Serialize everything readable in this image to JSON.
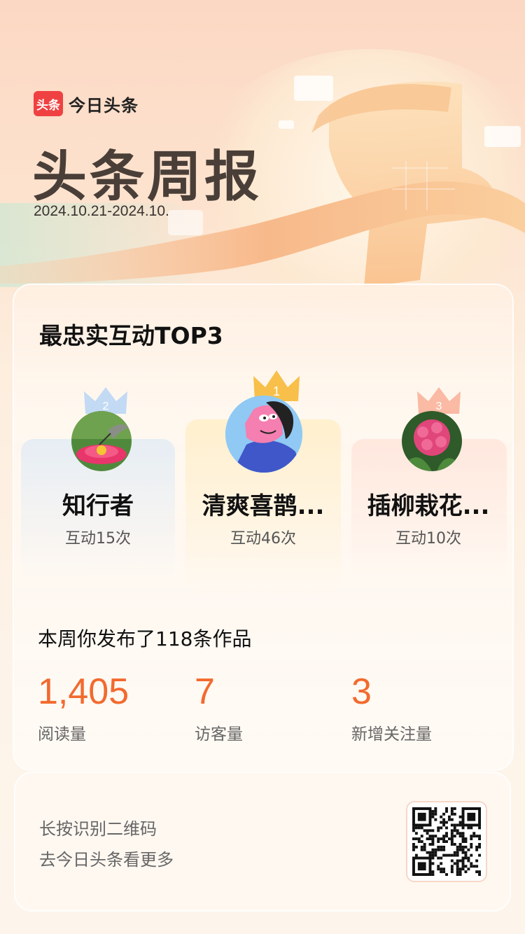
{
  "app": {
    "logo_badge": "头条",
    "logo_text": "今日头条"
  },
  "hero": {
    "title": "头条周报",
    "date_range": "2024.10.21-2024.10."
  },
  "top3": {
    "title": "最忠实互动TOP3",
    "ranks": [
      {
        "rank": "2",
        "name": "知行者",
        "count": "互动15次",
        "avatar_icon": "hummingbird-flower-avatar"
      },
      {
        "rank": "1",
        "name": "清爽喜鹊...",
        "count": "互动46次",
        "avatar_icon": "cartoon-dog-avatar"
      },
      {
        "rank": "3",
        "name": "插柳栽花...",
        "count": "互动10次",
        "avatar_icon": "hydrangea-avatar"
      }
    ]
  },
  "week": {
    "summary": "本周你发布了118条作品",
    "stats": [
      {
        "value": "1,405",
        "label": "阅读量"
      },
      {
        "value": "7",
        "label": "访客量"
      },
      {
        "value": "3",
        "label": "新增关注量"
      }
    ]
  },
  "footer": {
    "line1": "长按识别二维码",
    "line2": "去今日头条看更多"
  },
  "colors": {
    "accent": "#f26a2e",
    "brand_red": "#f04142",
    "gold": "#f6b733",
    "silver": "#a9c8ef",
    "bronze": "#f7a48b"
  }
}
